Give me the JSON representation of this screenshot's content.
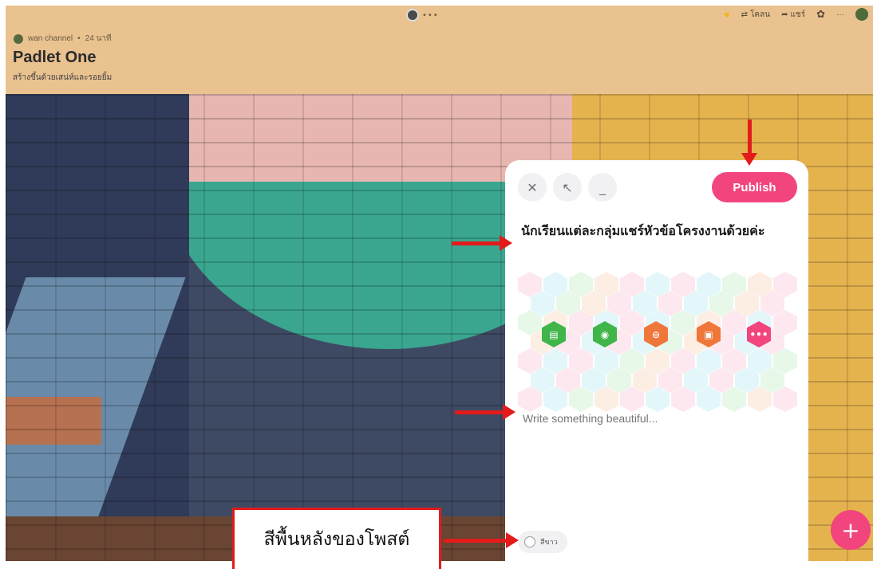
{
  "header": {
    "channel_name": "wan channel",
    "time_ago": "24 นาที",
    "board_title": "Padlet One",
    "board_subtitle": "สร้างขึ้นด้วยเสน่ห์และรอยยิ้ม",
    "remake_label": "โคลน",
    "share_label": "แชร์",
    "more_label": "···"
  },
  "composer": {
    "publish_label": "Publish",
    "post_title": "นักเรียนแต่ละกลุ่มแชร์หัวข้อโครงงานด้วยค่ะ",
    "body_placeholder": "Write something beautiful...",
    "background_color_label": "สีขาว",
    "attachments": [
      {
        "name": "upload-file",
        "color": "#3fb54a"
      },
      {
        "name": "camera",
        "color": "#3fb54a"
      },
      {
        "name": "link",
        "color": "#f0773a"
      },
      {
        "name": "image-search",
        "color": "#f0773a"
      },
      {
        "name": "more-options",
        "color": "#f2457d"
      }
    ]
  },
  "annotation": {
    "callout_text": "สีพื้นหลังของโพสต์"
  },
  "colors": {
    "header_bg": "#e9c28f",
    "accent": "#f2457d",
    "annotation": "#e31b1b"
  }
}
